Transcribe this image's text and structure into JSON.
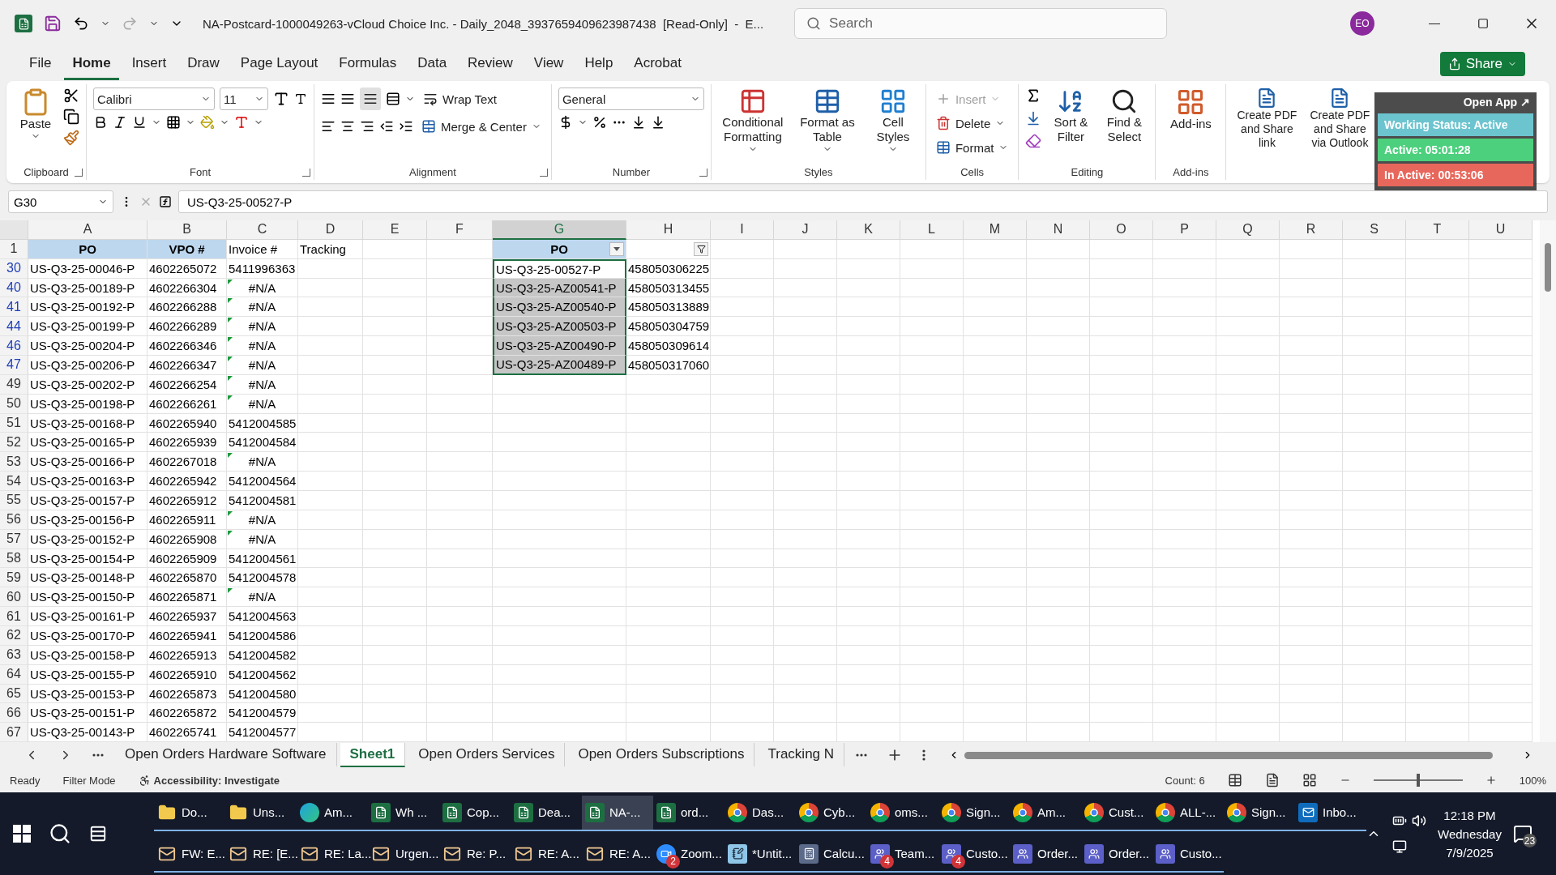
{
  "title_bar": {
    "title": "NA-Postcard-1000049263-vCloud Choice Inc. - Daily_2048_3937659409623987438  [Read-Only]  -  E...",
    "search_placeholder": "Search",
    "avatar": "EO"
  },
  "menu_tabs": [
    {
      "label": "File",
      "selected": false
    },
    {
      "label": "Home",
      "selected": true
    },
    {
      "label": "Insert",
      "selected": false
    },
    {
      "label": "Draw",
      "selected": false
    },
    {
      "label": "Page Layout",
      "selected": false
    },
    {
      "label": "Formulas",
      "selected": false
    },
    {
      "label": "Data",
      "selected": false
    },
    {
      "label": "Review",
      "selected": false
    },
    {
      "label": "View",
      "selected": false
    },
    {
      "label": "Help",
      "selected": false
    },
    {
      "label": "Acrobat",
      "selected": false
    }
  ],
  "share_button": "Share",
  "ribbon": {
    "clipboard": {
      "label": "Clipboard",
      "paste": "Paste"
    },
    "font": {
      "label": "Font",
      "name": "Calibri",
      "size": "11"
    },
    "alignment": {
      "label": "Alignment",
      "wrap": "Wrap Text",
      "merge": "Merge & Center"
    },
    "number": {
      "label": "Number",
      "format": "General"
    },
    "styles": {
      "label": "Styles",
      "buttons": [
        "Conditional Formatting",
        "Format as Table",
        "Cell Styles"
      ]
    },
    "cells": {
      "label": "Cells",
      "buttons": [
        {
          "label": "Insert",
          "disabled": true
        },
        {
          "label": "Delete",
          "disabled": false
        },
        {
          "label": "Format",
          "disabled": false
        }
      ]
    },
    "editing": {
      "label": "Editing",
      "buttons": [
        "Sort & Filter",
        "Find & Select"
      ]
    },
    "addins": {
      "label": "Add-ins",
      "button": "Add-ins"
    },
    "acrobat": {
      "buttons": [
        "Create PDF and Share link",
        "Create PDF and Share via Outlook"
      ]
    }
  },
  "formula_bar": {
    "name_box": "G30",
    "formula": "US-Q3-25-00527-P"
  },
  "columns": [
    {
      "label": "A",
      "selected": false
    },
    {
      "label": "B",
      "selected": false
    },
    {
      "label": "C",
      "selected": false
    },
    {
      "label": "D",
      "selected": false
    },
    {
      "label": "E",
      "selected": false
    },
    {
      "label": "F",
      "selected": false
    },
    {
      "label": "G",
      "selected": true
    },
    {
      "label": "H",
      "selected": false
    },
    {
      "label": "I",
      "selected": false
    },
    {
      "label": "J",
      "selected": false
    },
    {
      "label": "K",
      "selected": false
    },
    {
      "label": "L",
      "selected": false
    },
    {
      "label": "M",
      "selected": false
    },
    {
      "label": "N",
      "selected": false
    },
    {
      "label": "O",
      "selected": false
    },
    {
      "label": "P",
      "selected": false
    },
    {
      "label": "Q",
      "selected": false
    },
    {
      "label": "R",
      "selected": false
    },
    {
      "label": "S",
      "selected": false
    },
    {
      "label": "T",
      "selected": false
    },
    {
      "label": "U",
      "selected": false
    }
  ],
  "header_row": {
    "num": "1",
    "cells": [
      {
        "text": "PO",
        "highlighted": true
      },
      {
        "text": "VPO #",
        "highlighted": true
      },
      {
        "text": "Invoice #",
        "highlighted": false
      },
      {
        "text": "Tracking",
        "highlighted": false
      }
    ],
    "g": {
      "text": "PO",
      "highlighted": true
    }
  },
  "rows": [
    {
      "num": "30",
      "filtered": true,
      "a": "US-Q3-25-00046-P",
      "b": "4602265072",
      "c": {
        "text": "5411996363",
        "error": false
      },
      "g": {
        "text": "US-Q3-25-00527-P",
        "highlighted": false
      },
      "h": "458050306225"
    },
    {
      "num": "40",
      "filtered": true,
      "a": "US-Q3-25-00189-P",
      "b": "4602266304",
      "c": {
        "text": "#N/A",
        "error": true
      },
      "g": {
        "text": "US-Q3-25-AZ00541-P",
        "highlighted": true
      },
      "h": "458050313455"
    },
    {
      "num": "41",
      "filtered": true,
      "a": "US-Q3-25-00192-P",
      "b": "4602266288",
      "c": {
        "text": "#N/A",
        "error": true
      },
      "g": {
        "text": "US-Q3-25-AZ00540-P",
        "highlighted": true
      },
      "h": "458050313889"
    },
    {
      "num": "44",
      "filtered": true,
      "a": "US-Q3-25-00199-P",
      "b": "4602266289",
      "c": {
        "text": "#N/A",
        "error": true
      },
      "g": {
        "text": "US-Q3-25-AZ00503-P",
        "highlighted": true
      },
      "h": "458050304759"
    },
    {
      "num": "46",
      "filtered": true,
      "a": "US-Q3-25-00204-P",
      "b": "4602266346",
      "c": {
        "text": "#N/A",
        "error": true
      },
      "g": {
        "text": "US-Q3-25-AZ00490-P",
        "highlighted": true
      },
      "h": "458050309614"
    },
    {
      "num": "47",
      "filtered": true,
      "a": "US-Q3-25-00206-P",
      "b": "4602266347",
      "c": {
        "text": "#N/A",
        "error": true
      },
      "g": {
        "text": "US-Q3-25-AZ00489-P",
        "highlighted": true
      },
      "h": "458050317060"
    },
    {
      "num": "49",
      "filtered": false,
      "a": "US-Q3-25-00202-P",
      "b": "4602266254",
      "c": {
        "text": "#N/A",
        "error": true
      }
    },
    {
      "num": "50",
      "filtered": false,
      "a": "US-Q3-25-00198-P",
      "b": "4602266261",
      "c": {
        "text": "#N/A",
        "error": true
      }
    },
    {
      "num": "51",
      "filtered": false,
      "a": "US-Q3-25-00168-P",
      "b": "4602265940",
      "c": {
        "text": "5412004585",
        "error": false
      }
    },
    {
      "num": "52",
      "filtered": false,
      "a": "US-Q3-25-00165-P",
      "b": "4602265939",
      "c": {
        "text": "5412004584",
        "error": false
      }
    },
    {
      "num": "53",
      "filtered": false,
      "a": "US-Q3-25-00166-P",
      "b": "4602267018",
      "c": {
        "text": "#N/A",
        "error": true
      }
    },
    {
      "num": "54",
      "filtered": false,
      "a": "US-Q3-25-00163-P",
      "b": "4602265942",
      "c": {
        "text": "5412004564",
        "error": false
      }
    },
    {
      "num": "55",
      "filtered": false,
      "a": "US-Q3-25-00157-P",
      "b": "4602265912",
      "c": {
        "text": "5412004581",
        "error": false
      }
    },
    {
      "num": "56",
      "filtered": false,
      "a": "US-Q3-25-00156-P",
      "b": "4602265911",
      "c": {
        "text": "#N/A",
        "error": true
      }
    },
    {
      "num": "57",
      "filtered": false,
      "a": "US-Q3-25-00152-P",
      "b": "4602265908",
      "c": {
        "text": "#N/A",
        "error": true
      }
    },
    {
      "num": "58",
      "filtered": false,
      "a": "US-Q3-25-00154-P",
      "b": "4602265909",
      "c": {
        "text": "5412004561",
        "error": false
      }
    },
    {
      "num": "59",
      "filtered": false,
      "a": "US-Q3-25-00148-P",
      "b": "4602265870",
      "c": {
        "text": "5412004578",
        "error": false
      }
    },
    {
      "num": "60",
      "filtered": false,
      "a": "US-Q3-25-00150-P",
      "b": "4602265871",
      "c": {
        "text": "#N/A",
        "error": true
      }
    },
    {
      "num": "61",
      "filtered": false,
      "a": "US-Q3-25-00161-P",
      "b": "4602265937",
      "c": {
        "text": "5412004563",
        "error": false
      }
    },
    {
      "num": "62",
      "filtered": false,
      "a": "US-Q3-25-00170-P",
      "b": "4602265941",
      "c": {
        "text": "5412004586",
        "error": false
      }
    },
    {
      "num": "63",
      "filtered": false,
      "a": "US-Q3-25-00158-P",
      "b": "4602265913",
      "c": {
        "text": "5412004582",
        "error": false
      }
    },
    {
      "num": "64",
      "filtered": false,
      "a": "US-Q3-25-00155-P",
      "b": "4602265910",
      "c": {
        "text": "5412004562",
        "error": false
      }
    },
    {
      "num": "65",
      "filtered": false,
      "a": "US-Q3-25-00153-P",
      "b": "4602265873",
      "c": {
        "text": "5412004580",
        "error": false
      }
    },
    {
      "num": "66",
      "filtered": false,
      "a": "US-Q3-25-00151-P",
      "b": "4602265872",
      "c": {
        "text": "5412004579",
        "error": false
      }
    },
    {
      "num": "67",
      "filtered": false,
      "a": "US-Q3-25-00143-P",
      "b": "4602265741",
      "c": {
        "text": "5412004577",
        "error": false
      }
    }
  ],
  "sheet_tabs": [
    {
      "label": "Open Orders Hardware Software",
      "selected": false
    },
    {
      "label": "Sheet1",
      "selected": true
    },
    {
      "label": "Open Orders Services",
      "selected": false
    },
    {
      "label": "Open Orders Subscriptions",
      "selected": false
    },
    {
      "label": "Tracking N",
      "selected": false
    }
  ],
  "status_bar": {
    "ready": "Ready",
    "mode": "Filter Mode",
    "accessibility": "Accessibility: Investigate",
    "count": "Count: 6",
    "zoom": "100%",
    "zoom_level": {
      "level": 0.5
    }
  },
  "widget": {
    "open_app": "Open App ↗",
    "items": [
      {
        "text": "Working Status: Active",
        "color": "#6cc4cf"
      },
      {
        "text": "Active: 05:01:28",
        "color": "#4cd07d"
      },
      {
        "text": "In Active: 00:53:06",
        "color": "#e8675c"
      }
    ]
  },
  "taskbar": {
    "row_1": [
      {
        "kind": "folder",
        "label": "Do...",
        "selected": false
      },
      {
        "kind": "folder",
        "label": "Uns...",
        "selected": false
      },
      {
        "kind": "edge",
        "label": "Am...",
        "selected": false
      },
      {
        "kind": "excel",
        "label": "Wh ...",
        "selected": false
      },
      {
        "kind": "excel",
        "label": "Cop...",
        "selected": false
      },
      {
        "kind": "excel",
        "label": "Dea...",
        "selected": false
      },
      {
        "kind": "excel",
        "label": "NA-...",
        "selected": true
      },
      {
        "kind": "excel",
        "label": "ord...",
        "selected": false
      },
      {
        "kind": "chrome",
        "label": "Das...",
        "selected": false
      },
      {
        "kind": "chrome",
        "label": "Cyb...",
        "selected": false
      },
      {
        "kind": "chrome",
        "label": "oms...",
        "selected": false
      },
      {
        "kind": "chrome",
        "label": "Sign...",
        "selected": false
      },
      {
        "kind": "chrome",
        "label": "Am...",
        "selected": false
      },
      {
        "kind": "chrome",
        "label": "Cust...",
        "selected": false
      },
      {
        "kind": "chrome",
        "label": "ALL-...",
        "selected": false
      },
      {
        "kind": "chrome",
        "label": "Sign...",
        "selected": false
      },
      {
        "kind": "outlook",
        "label": "Inbo...",
        "selected": false
      }
    ],
    "row_2": [
      {
        "kind": "mail",
        "label": "FW: E...",
        "selected": false
      },
      {
        "kind": "mail",
        "label": "RE: [E...",
        "selected": false
      },
      {
        "kind": "mail",
        "label": "RE: La...",
        "selected": false
      },
      {
        "kind": "mail",
        "label": "Urgen...",
        "selected": false
      },
      {
        "kind": "mail",
        "label": "Re: P...",
        "selected": false
      },
      {
        "kind": "mail",
        "label": "RE: A...",
        "selected": false
      },
      {
        "kind": "mail",
        "label": "RE: A...",
        "selected": false
      },
      {
        "kind": "zoom",
        "label": "Zoom...",
        "badge": "2",
        "selected": false
      },
      {
        "kind": "notepad",
        "label": "*Untit...",
        "selected": false
      },
      {
        "kind": "calc",
        "label": "Calcu...",
        "selected": false
      },
      {
        "kind": "teams",
        "label": "Team...",
        "badge": "4",
        "selected": false
      },
      {
        "kind": "teams",
        "label": "Custo...",
        "badge": "4",
        "selected": false
      },
      {
        "kind": "teams",
        "label": "Order...",
        "selected": false
      },
      {
        "kind": "teams",
        "label": "Order...",
        "selected": false
      },
      {
        "kind": "teams",
        "label": "Custo...",
        "selected": false
      }
    ],
    "clock": {
      "time": "12:18 PM",
      "day": "Wednesday",
      "date": "7/9/2025"
    },
    "notifications": "23"
  }
}
